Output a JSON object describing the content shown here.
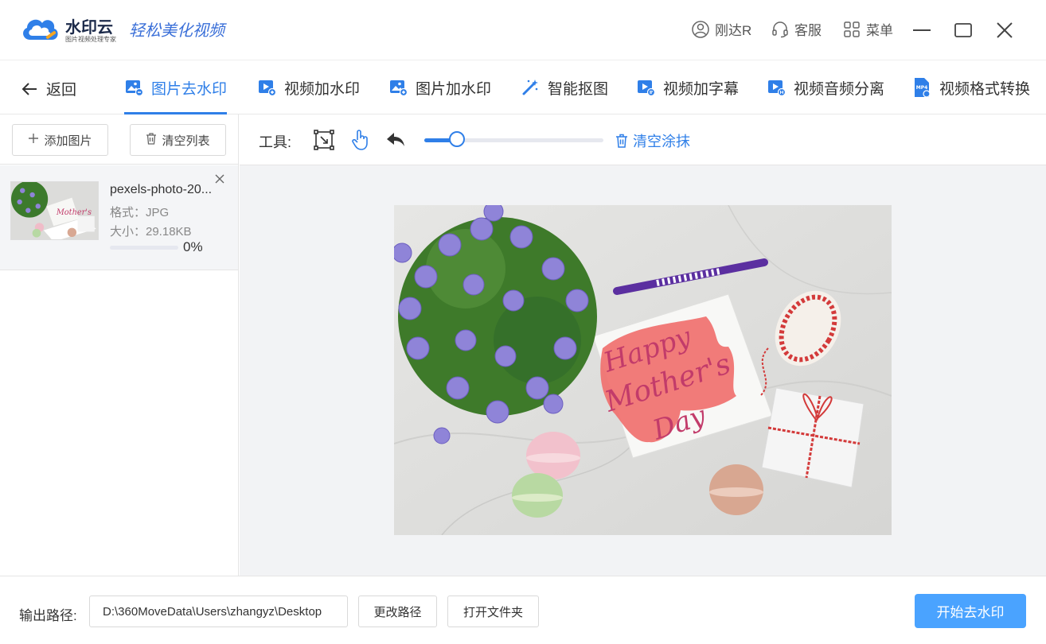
{
  "app": {
    "brand": "水印云",
    "brand_sub": "图片视频处理专家",
    "slogan": "轻松美化视频"
  },
  "titlebar": {
    "user": "刚达R",
    "service": "客服",
    "menu": "菜单"
  },
  "nav": {
    "back": "返回",
    "tabs": [
      {
        "label": "图片去水印",
        "icon": "image-remove-watermark-icon"
      },
      {
        "label": "视频加水印",
        "icon": "video-add-watermark-icon"
      },
      {
        "label": "图片加水印",
        "icon": "image-add-watermark-icon"
      },
      {
        "label": "智能抠图",
        "icon": "magic-wand-icon"
      },
      {
        "label": "视频加字幕",
        "icon": "video-subtitle-icon"
      },
      {
        "label": "视频音频分离",
        "icon": "video-audio-split-icon"
      },
      {
        "label": "视频格式转换",
        "icon": "mp4-convert-icon"
      }
    ],
    "active_tab": 0
  },
  "sidebar": {
    "add_label": "添加图片",
    "clear_label": "清空列表",
    "files": [
      {
        "name": "pexels-photo-20...",
        "format": "格式：JPG",
        "size": "大小：29.18KB",
        "progress": 0,
        "progress_text": "0%"
      }
    ]
  },
  "toolbar": {
    "label": "工具:",
    "brush_level": 0.18,
    "clear_paint": "清空涂抹"
  },
  "bottom": {
    "output_label": "输出路径:",
    "output_path": "D:\\360MoveData\\Users\\zhangyz\\Desktop",
    "change_path": "更改路径",
    "open_folder": "打开文件夹",
    "start": "开始去水印"
  },
  "image_text": {
    "line1": "Happy",
    "line2": "Mother's",
    "line3": "Day"
  },
  "colors": {
    "accent": "#2f7fe8",
    "primary_button": "#4aa3ff",
    "mask": "#f0706e"
  }
}
